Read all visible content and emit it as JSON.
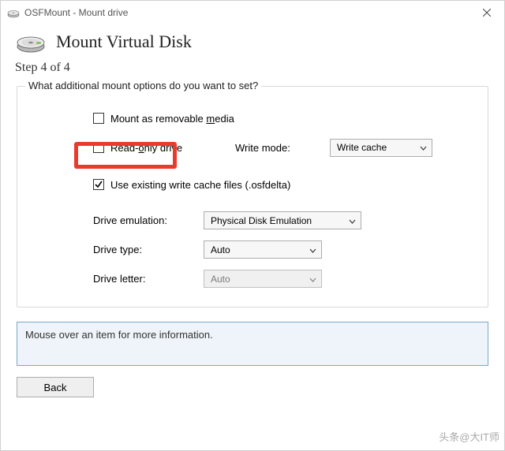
{
  "titlebar": {
    "title": "OSFMount - Mount drive"
  },
  "header": {
    "heading": "Mount Virtual Disk"
  },
  "step": "Step 4 of 4",
  "group": {
    "legend": "What additional mount options do you want to set?",
    "removable": {
      "label_pre": "Mount as removable ",
      "label_accel": "m",
      "label_post": "edia",
      "checked": false
    },
    "readonly": {
      "label_pre": "Read-",
      "label_accel": "o",
      "label_post": "nly drive",
      "checked": false
    },
    "write_mode": {
      "label": "Write mode:",
      "value": "Write cache"
    },
    "use_cache": {
      "label": "Use existing write cache files (.osfdelta)",
      "checked": true
    },
    "emulation": {
      "label": "Drive emulation:",
      "value": "Physical Disk Emulation"
    },
    "type": {
      "label": "Drive type:",
      "value": "Auto"
    },
    "letter": {
      "label": "Drive letter:",
      "value": "Auto",
      "disabled": true
    }
  },
  "info": "Mouse over an item for more information.",
  "buttons": {
    "back": "Back"
  },
  "watermark": "头条@大IT师"
}
